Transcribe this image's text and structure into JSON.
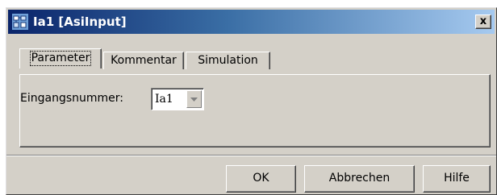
{
  "window": {
    "title": "Ia1 [AsiInput]",
    "close_glyph": "x",
    "title_icon": "asi-module-icon"
  },
  "tabs": [
    {
      "label": "Parameter",
      "active": true
    },
    {
      "label": "Kommentar",
      "active": false
    },
    {
      "label": "Simulation",
      "active": false
    }
  ],
  "parameter": {
    "input_number_label": "Eingangsnummer:",
    "input_number_value": "Ia1"
  },
  "buttons": {
    "ok": "OK",
    "cancel": "Abbrechen",
    "help": "Hilfe"
  },
  "colors": {
    "titlebar_start": "#0a246a",
    "titlebar_end": "#a6caf0",
    "face": "#d4d0c8"
  }
}
